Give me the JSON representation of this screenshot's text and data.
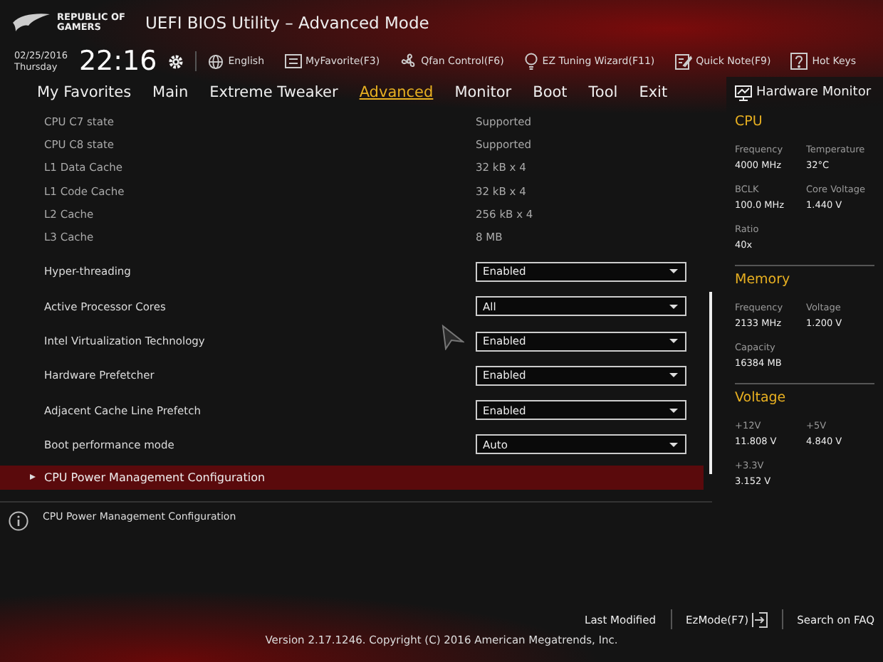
{
  "header": {
    "brand": [
      "REPUBLIC OF",
      "GAMERS"
    ],
    "title": "UEFI BIOS Utility – Advanced Mode"
  },
  "clock": {
    "date": "02/25/2016",
    "day": "Thursday",
    "time": "22:16"
  },
  "toolbar": [
    {
      "kind": "globe",
      "label": "English"
    },
    {
      "kind": "list",
      "label": "MyFavorite(F3)"
    },
    {
      "kind": "fan",
      "label": "Qfan Control(F6)"
    },
    {
      "kind": "bulb",
      "label": "EZ Tuning Wizard(F11)"
    },
    {
      "kind": "note",
      "label": "Quick Note(F9)"
    },
    {
      "kind": "help",
      "label": "Hot Keys"
    }
  ],
  "tabs": [
    {
      "label": "My Favorites",
      "selected": false
    },
    {
      "label": "Main",
      "selected": false
    },
    {
      "label": "Extreme Tweaker",
      "selected": false
    },
    {
      "label": "Advanced",
      "selected": true
    },
    {
      "label": "Monitor",
      "selected": false
    },
    {
      "label": "Boot",
      "selected": false
    },
    {
      "label": "Tool",
      "selected": false
    },
    {
      "label": "Exit",
      "selected": false
    }
  ],
  "info_rows": [
    {
      "label": "CPU C7 state",
      "value": "Supported"
    },
    {
      "label": "CPU C8 state",
      "value": "Supported"
    },
    {
      "label": "L1 Data Cache",
      "value": "32 kB x 4"
    },
    {
      "label": "L1 Code Cache",
      "value": "32 kB x 4"
    },
    {
      "label": "L2 Cache",
      "value": "256 kB x 4"
    },
    {
      "label": "L3 Cache",
      "value": "8 MB"
    }
  ],
  "settings": [
    {
      "label": "Hyper-threading",
      "value": "Enabled"
    },
    {
      "label": "Active Processor Cores",
      "value": "All"
    },
    {
      "label": "Intel Virtualization Technology",
      "value": "Enabled"
    },
    {
      "label": "Hardware Prefetcher",
      "value": "Enabled"
    },
    {
      "label": "Adjacent Cache Line Prefetch",
      "value": "Enabled"
    },
    {
      "label": "Boot performance mode",
      "value": "Auto"
    }
  ],
  "submenu": {
    "label": "CPU Power Management Configuration",
    "selected": true
  },
  "help": {
    "text": "CPU Power Management Configuration"
  },
  "hardware_monitor": {
    "title": "Hardware Monitor",
    "sections": [
      {
        "title": "CPU",
        "items": [
          {
            "label": "Frequency",
            "value": "4000 MHz"
          },
          {
            "label": "Temperature",
            "value": "32°C"
          },
          {
            "label": "BCLK",
            "value": "100.0 MHz"
          },
          {
            "label": "Core Voltage",
            "value": "1.440 V"
          },
          {
            "label": "Ratio",
            "value": "40x"
          }
        ]
      },
      {
        "title": "Memory",
        "items": [
          {
            "label": "Frequency",
            "value": "2133 MHz"
          },
          {
            "label": "Voltage",
            "value": "1.200 V"
          },
          {
            "label": "Capacity",
            "value": "16384 MB"
          }
        ]
      },
      {
        "title": "Voltage",
        "items": [
          {
            "label": "+12V",
            "value": "11.808 V"
          },
          {
            "label": "+5V",
            "value": "4.840 V"
          },
          {
            "label": "+3.3V",
            "value": "3.152 V"
          }
        ]
      }
    ]
  },
  "footer": {
    "links": [
      {
        "kind": "text",
        "label": "Last Modified"
      },
      {
        "kind": "exit",
        "label": "EzMode(F7)"
      },
      {
        "kind": "text",
        "label": "Search on FAQ"
      }
    ],
    "version": "Version 2.17.1246. Copyright (C) 2016 American Megatrends, Inc."
  }
}
